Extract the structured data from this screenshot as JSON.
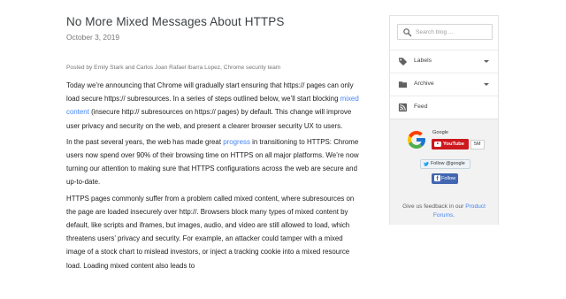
{
  "post": {
    "title": "No More Mixed Messages About HTTPS",
    "date": "October 3, 2019",
    "byline": "Posted by Emily Stark and Carlos Joan Rafael Ibarra Lopez, Chrome security team",
    "p1": {
      "before": "Today we’re announcing that Chrome will gradually start ensuring that https:// pages can only load secure https:// subresources. In a series of steps outlined below, we’ll start blocking ",
      "link": "mixed content",
      "after": " (insecure http:// subresources on https:// pages) by default. This change will improve user privacy and security on the web, and present a clearer browser security UX to users."
    },
    "p2": {
      "before": "In the past several years, the web has made great ",
      "link": "progress",
      "after": " in transitioning to HTTPS: Chrome users now spend over 90% of their browsing time on HTTPS on all major platforms. We’re now turning our attention to making sure that HTTPS configurations across the web are secure and up-to-date."
    },
    "p3": "HTTPS pages commonly suffer from a problem called mixed content, where subresources on the page are loaded insecurely over http://. Browsers block many types of mixed content by default, like scripts and iframes, but images, audio, and video are still allowed to load, which threatens users’ privacy and security. For example, an attacker could tamper with a mixed image of a stock chart to mislead investors, or inject a tracking cookie into a mixed resource load. Loading mixed content also leads to"
  },
  "sidebar": {
    "search": {
      "placeholder": "Search blog ..."
    },
    "labels": "Labels",
    "archive": "Archive",
    "feed": "Feed",
    "social": {
      "google_name": "Google",
      "youtube_label": "YouTube",
      "youtube_count": "5M",
      "twitter_label": "Follow @google",
      "facebook_label": "Follow"
    },
    "feedback": {
      "before": "Give us feedback in our ",
      "link": "Product Forums",
      "after": "."
    }
  },
  "colors": {
    "link": "#4285f4",
    "youtube": "#cc181e",
    "facebook": "#4267b2",
    "sidebar_bg": "#f2f2f2"
  }
}
